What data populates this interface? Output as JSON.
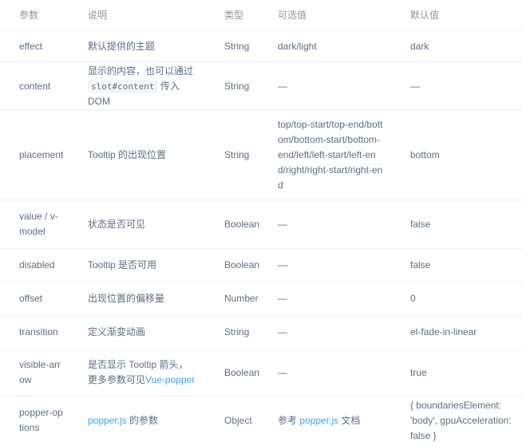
{
  "headers": [
    "参数",
    "说明",
    "类型",
    "可选值",
    "默认值"
  ],
  "rows": [
    {
      "param": "effect",
      "desc": "默认提供的主题",
      "type": "String",
      "options": "dark/light",
      "default": "dark"
    },
    {
      "param": "content",
      "desc_pre": "显示的内容，也可以通过",
      "desc_code": "slot#content",
      "desc_post": "传入 DOM",
      "type": "String",
      "options": "—",
      "default": "—"
    },
    {
      "param": "placement",
      "desc": "Tooltip 的出现位置",
      "type": "String",
      "options": "top/top-start/top-end/bottom/bottom-start/bottom-end/left/left-start/left-end/right/right-start/right-end",
      "default": "bottom"
    },
    {
      "param": "value / v-model",
      "desc": "状态是否可见",
      "type": "Boolean",
      "options": "—",
      "default": "false"
    },
    {
      "param": "disabled",
      "desc": "Tooltip 是否可用",
      "type": "Boolean",
      "options": "—",
      "default": "false"
    },
    {
      "param": "offset",
      "desc": "出现位置的偏移量",
      "type": "Number",
      "options": "—",
      "default": "0"
    },
    {
      "param": "transition",
      "desc": "定义渐变动画",
      "type": "String",
      "options": "—",
      "default": "el-fade-in-linear"
    },
    {
      "param": "visible-arrow",
      "desc_pre": "是否显示 Tooltip 箭头，更多参数可见",
      "desc_link": "Vue-popper",
      "type": "Boolean",
      "options": "—",
      "default": "true"
    },
    {
      "param": "popper-options",
      "desc_link": "popper.js",
      "desc_post": " 的参数",
      "type": "Object",
      "options_pre": "参考 ",
      "options_link": "popper.js",
      "options_post": " 文档",
      "default": "{ boundariesElement: 'body', gpuAcceleration: false }"
    }
  ],
  "colors": {
    "text": "#5e6d82",
    "header": "#909399",
    "link": "#409eff",
    "border": "#eaeefb"
  }
}
